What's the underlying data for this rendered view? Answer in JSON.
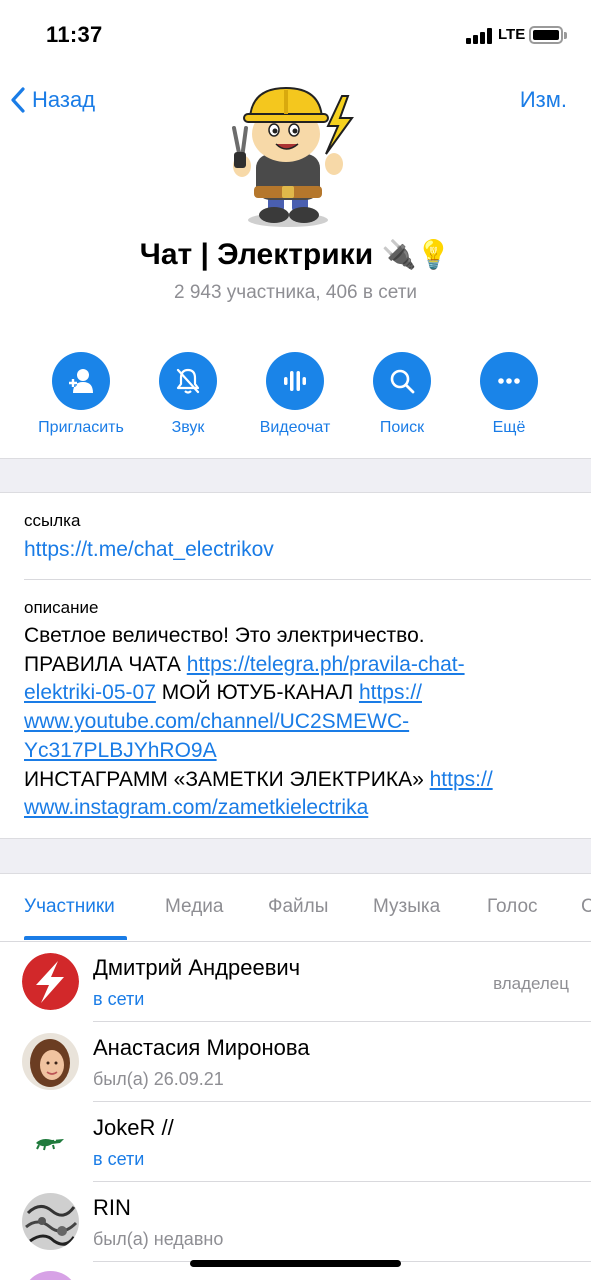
{
  "status_bar": {
    "time": "11:37",
    "network": "LTE"
  },
  "nav": {
    "back_label": "Назад",
    "edit_label": "Изм."
  },
  "group": {
    "title": "Чат | Электрики",
    "title_emoji": "🔌💡",
    "subtitle": "2 943 участника, 406 в сети"
  },
  "actions": [
    {
      "label": "Пригласить",
      "icon": "add-user-icon"
    },
    {
      "label": "Звук",
      "icon": "bell-muted-icon"
    },
    {
      "label": "Видеочат",
      "icon": "voice-chat-icon"
    },
    {
      "label": "Поиск",
      "icon": "search-icon"
    },
    {
      "label": "Ещё",
      "icon": "more-icon"
    }
  ],
  "info": {
    "link_label": "ссылка",
    "link_value": "https://t.me/chat_electrikov",
    "description_label": "описание",
    "description": {
      "line1": "Светлое величество! Это электричество.",
      "rules_prefix": "ПРАВИЛА ЧАТА ",
      "rules_link_a": "https://telegra.ph/pravila-chat-",
      "rules_link_b": "elektriki-05-07",
      "youtube_prefix": " МОЙ ЮТУБ-КАНАЛ ",
      "youtube_link_a": "https://",
      "youtube_link_b": "www.youtube.com/channel/UC2SMEWC-",
      "youtube_link_c": "Yc317PLBJYhRO9A",
      "instagram_prefix": "ИНСТАГРАММ «ЗАМЕТКИ ЭЛЕКТРИКА» ",
      "instagram_link_a": "https://",
      "instagram_link_b": "www.instagram.com/zametkielectrika"
    }
  },
  "tabs": [
    {
      "label": "Участники",
      "active": true
    },
    {
      "label": "Медиа",
      "active": false
    },
    {
      "label": "Файлы",
      "active": false
    },
    {
      "label": "Музыка",
      "active": false
    },
    {
      "label": "Голос",
      "active": false
    },
    {
      "label": "С",
      "active": false
    }
  ],
  "members": [
    {
      "first": "Дмитрий ",
      "last": "Андреевич",
      "status": "в сети",
      "online": true,
      "role": "владелец",
      "avatar": "lightning-avatar"
    },
    {
      "first": "Анастасия ",
      "last": "Миронова",
      "status": "был(а) 26.09.21",
      "online": false,
      "role": "",
      "avatar": "photo-avatar"
    },
    {
      "first": "",
      "last": "JokeR //",
      "status": "в сети",
      "online": true,
      "role": "",
      "avatar": "crocodile-avatar"
    },
    {
      "first": "",
      "last": "RIN",
      "status": "был(а) недавно",
      "online": false,
      "role": "",
      "avatar": "pattern-avatar"
    }
  ],
  "colors": {
    "accent": "#1a7ce6",
    "secondary_text": "#8e8e93",
    "separator_band": "#efeff4"
  }
}
